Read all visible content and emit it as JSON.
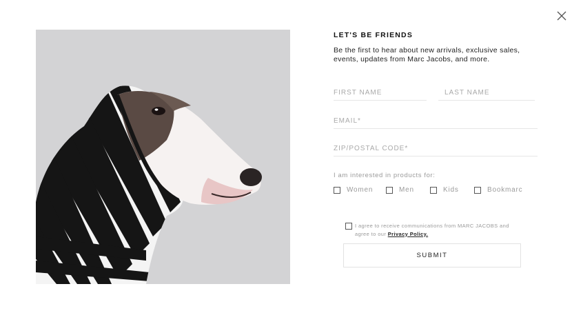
{
  "modal": {
    "close_icon": "close-icon",
    "image_alt": "Bull terrier wearing a black and white striped hood"
  },
  "form": {
    "title": "LET'S BE FRIENDS",
    "intro": "Be the first to hear about new arrivals, exclusive sales, events, updates from Marc Jacobs, and more.",
    "fields": {
      "first_name": "FIRST NAME",
      "last_name": "LAST NAME",
      "email": "EMAIL*",
      "zip": "ZIP/POSTAL CODE*"
    },
    "interest_label": "I am interested in products for:",
    "interests": [
      "Women",
      "Men",
      "Kids",
      "Bookmarc"
    ],
    "consent_text": "I agree to receive communications from MARC JACOBS and agree to our",
    "privacy_link": "Privacy Policy.",
    "submit_label": "SUBMIT"
  }
}
